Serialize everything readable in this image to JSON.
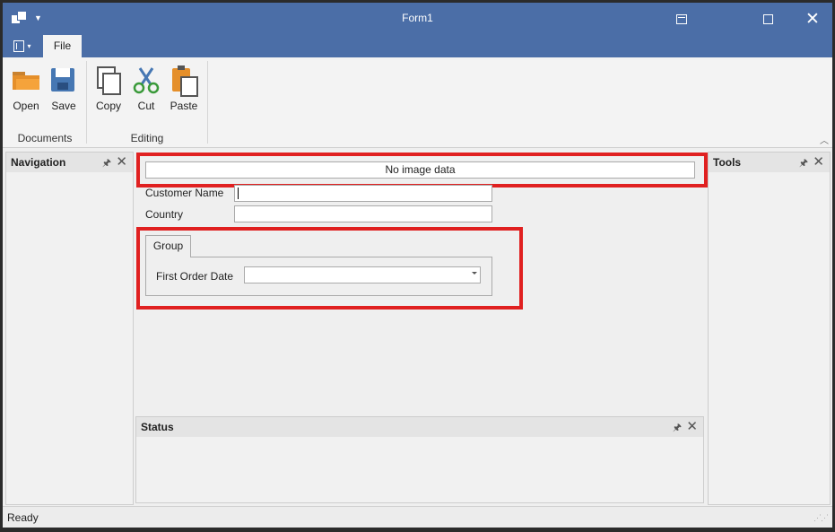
{
  "window": {
    "title": "Form1"
  },
  "ribbon": {
    "file_tab": "File",
    "groups": [
      {
        "label": "Documents",
        "buttons": [
          {
            "label": "Open",
            "icon": "folder-open-icon"
          },
          {
            "label": "Save",
            "icon": "save-icon"
          }
        ]
      },
      {
        "label": "Editing",
        "buttons": [
          {
            "label": "Copy",
            "icon": "copy-icon"
          },
          {
            "label": "Cut",
            "icon": "scissors-icon"
          },
          {
            "label": "Paste",
            "icon": "paste-icon"
          }
        ]
      }
    ]
  },
  "panels": {
    "navigation": "Navigation",
    "tools": "Tools",
    "status": "Status"
  },
  "form": {
    "picture_text": "No image data",
    "customer_name_label": "Customer Name",
    "customer_name_value": "",
    "country_label": "Country",
    "country_value": "",
    "group_label": "Group",
    "first_order_date_label": "First Order Date",
    "first_order_date_value": ""
  },
  "statusbar": {
    "text": "Ready"
  },
  "colors": {
    "title_bar": "#4b6ea7",
    "highlight": "#e02020"
  }
}
